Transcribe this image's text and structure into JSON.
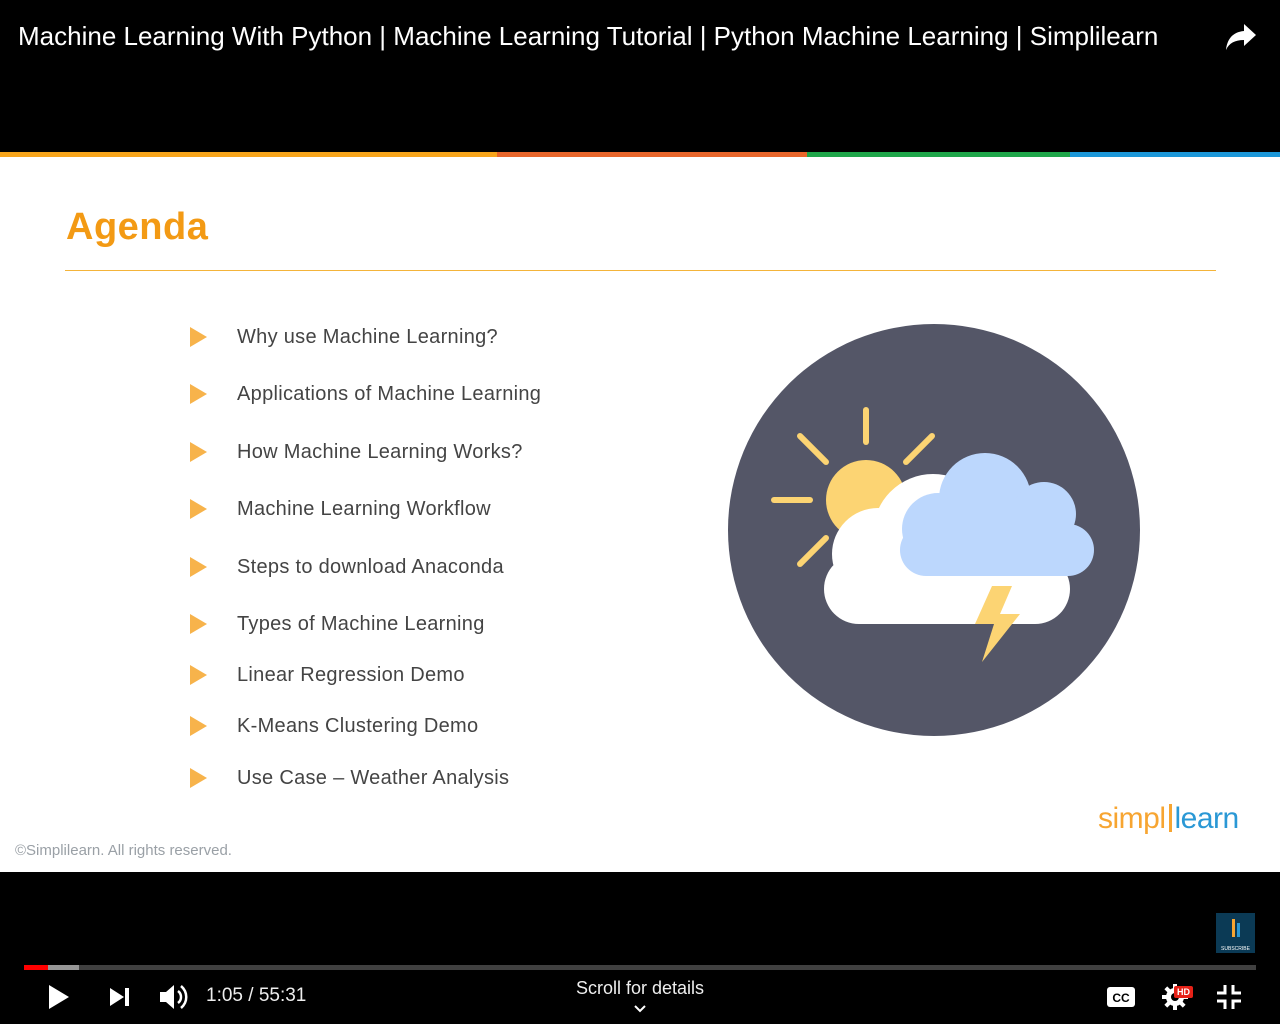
{
  "header": {
    "video_title": "Machine Learning With Python | Machine Learning Tutorial | Python Machine Learning | Simplilearn",
    "share_icon": "share-arrow-icon"
  },
  "slide": {
    "stripe_colors": [
      "#f7a51c",
      "#e8662b",
      "#1fa64a",
      "#1c97d8"
    ],
    "title": "Agenda",
    "title_color": "#f39a14",
    "rule_color": "#f4b43a",
    "bullet_icon": "play-triangle-icon",
    "bullet_color": "#f7b34b",
    "agenda_items": [
      "Why use Machine Learning?",
      "Applications of Machine Learning",
      "How Machine Learning Works?",
      "Machine Learning Workflow",
      "Steps to download Anaconda",
      "Types of Machine Learning",
      "Linear Regression Demo",
      "K-Means Clustering Demo",
      "Use Case – Weather Analysis"
    ],
    "illustration": {
      "icon": "weather-storm-icon",
      "circle_color": "#545667",
      "sun_color": "#fcd473",
      "cloud_front_color": "#ffffff",
      "cloud_back_color": "#bcd7fd",
      "lightning_color": "#fcd473"
    },
    "logo": {
      "part1": "simpl",
      "part2": "learn",
      "part1_color": "#f7a531",
      "part2_color": "#2a98d5"
    },
    "copyright": "©Simplilearn. All rights reserved."
  },
  "player": {
    "watermark_label": "SUBSCRIBE",
    "progress": {
      "played_fraction": 0.0196,
      "buffered_fraction": 0.045,
      "played_color": "#ff0000"
    },
    "current_time": "1:05",
    "duration": "55:31",
    "time_separator": " / ",
    "scroll_hint": "Scroll for details",
    "icons": {
      "play": "play-icon",
      "next": "next-icon",
      "volume": "volume-icon",
      "captions": "captions-icon",
      "settings": "settings-gear-icon",
      "hd_badge": "HD",
      "exit_fullscreen": "exit-fullscreen-icon",
      "chevron": "chevron-down-icon"
    }
  }
}
